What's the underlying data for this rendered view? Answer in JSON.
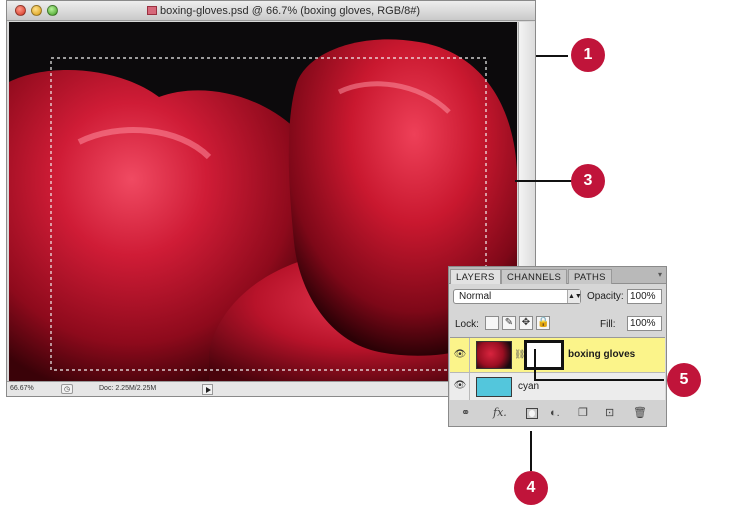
{
  "document": {
    "title": "boxing-gloves.psd @ 66.7% (boxing gloves, RGB/8#)",
    "zoom": "66.67%",
    "doc_size": "Doc: 2.25M/2.25M"
  },
  "layers_panel": {
    "tabs": [
      "LAYERS",
      "CHANNELS",
      "PATHS"
    ],
    "blend_mode": "Normal",
    "opacity_label": "Opacity:",
    "opacity_value": "100%",
    "lock_label": "Lock:",
    "fill_label": "Fill:",
    "fill_value": "100%",
    "layers": [
      {
        "name": "boxing gloves",
        "selected": true,
        "has_mask": true
      },
      {
        "name": "cyan",
        "selected": false,
        "has_mask": false
      }
    ],
    "bottom_icons": [
      "link-layers-icon",
      "fx-icon",
      "add-layer-mask-icon",
      "adjustment-layer-icon",
      "new-group-icon",
      "new-layer-icon",
      "trash-icon"
    ],
    "fx_label": "fx."
  },
  "callouts": [
    "1",
    "3",
    "5",
    "4"
  ],
  "colors": {
    "callout": "#c0143a",
    "selected_layer": "#fbf48a",
    "cyan_layer": "#53c6dc"
  }
}
